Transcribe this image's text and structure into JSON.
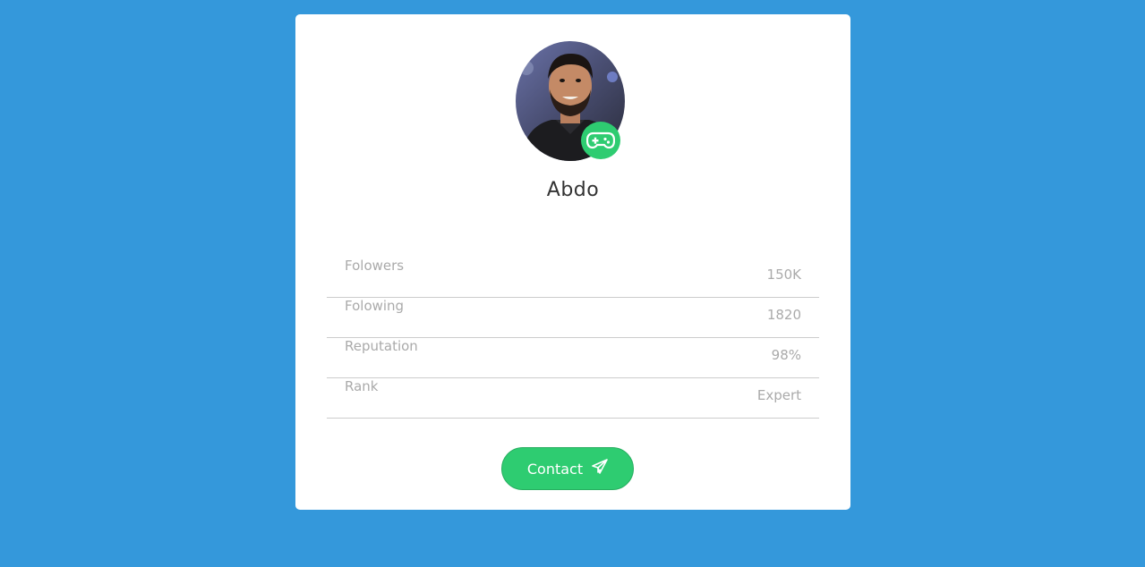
{
  "profile": {
    "name": "Abdo",
    "avatar_icon": "profile-photo",
    "badge_icon": "gamepad-icon"
  },
  "stats": [
    {
      "label": "Folowers",
      "value": "150K"
    },
    {
      "label": "Folowing",
      "value": "1820"
    },
    {
      "label": "Reputation",
      "value": "98%"
    },
    {
      "label": "Rank",
      "value": "Expert"
    }
  ],
  "contact": {
    "label": "Contact",
    "icon": "paper-plane-icon"
  },
  "colors": {
    "background": "#3498db",
    "accent": "#2ecc71",
    "card": "#ffffff",
    "muted_text": "#aaaaaa"
  }
}
